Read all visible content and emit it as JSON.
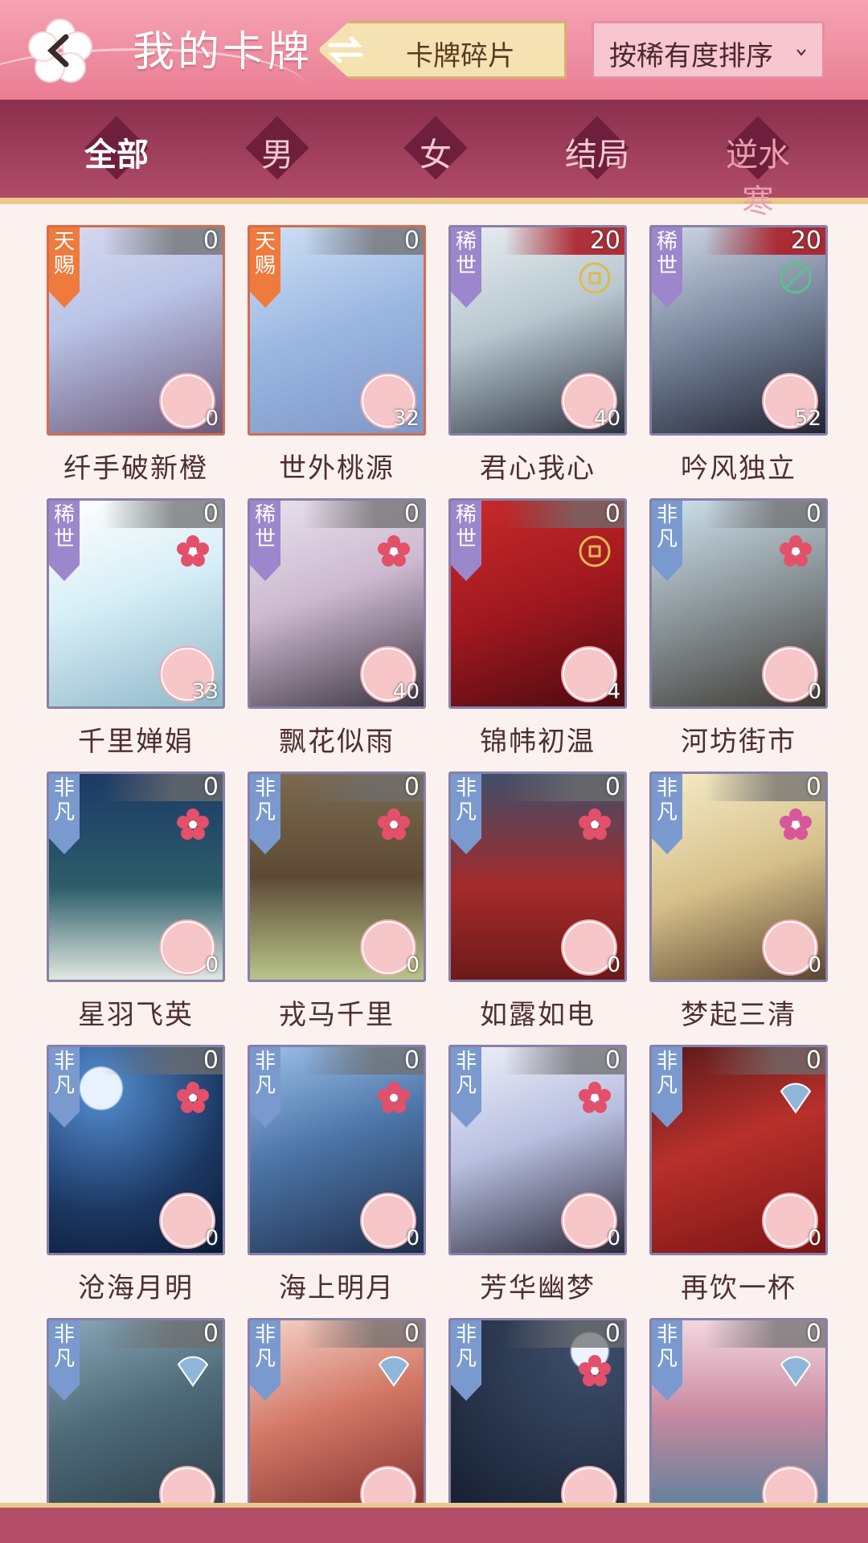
{
  "header": {
    "title": "我的卡牌",
    "switch_label": "卡牌碎片",
    "sort_label": "按稀有度排序"
  },
  "tabs": [
    {
      "label": "全部",
      "active": true
    },
    {
      "label": "男",
      "active": false
    },
    {
      "label": "女",
      "active": false
    },
    {
      "label": "结局",
      "active": false
    },
    {
      "label": "逆水寒",
      "active": false
    }
  ],
  "cards": [
    {
      "name": "纤手破新橙",
      "rarity": "天赐",
      "count": "0",
      "petals": "0"
    },
    {
      "name": "世外桃源",
      "rarity": "天赐",
      "count": "0",
      "petals": "32"
    },
    {
      "name": "君心我心",
      "rarity": "稀世",
      "count": "20",
      "petals": "40"
    },
    {
      "name": "吟风独立",
      "rarity": "稀世",
      "count": "20",
      "petals": "52"
    },
    {
      "name": "千里婵娟",
      "rarity": "稀世",
      "count": "0",
      "petals": "33"
    },
    {
      "name": "飘花似雨",
      "rarity": "稀世",
      "count": "0",
      "petals": "40"
    },
    {
      "name": "锦帏初温",
      "rarity": "稀世",
      "count": "0",
      "petals": "4"
    },
    {
      "name": "河坊街市",
      "rarity": "非凡",
      "count": "0",
      "petals": "0"
    },
    {
      "name": "星羽飞英",
      "rarity": "非凡",
      "count": "0",
      "petals": "0"
    },
    {
      "name": "戎马千里",
      "rarity": "非凡",
      "count": "0",
      "petals": "0"
    },
    {
      "name": "如露如电",
      "rarity": "非凡",
      "count": "0",
      "petals": "0"
    },
    {
      "name": "梦起三清",
      "rarity": "非凡",
      "count": "0",
      "petals": "0"
    },
    {
      "name": "沧海月明",
      "rarity": "非凡",
      "count": "0",
      "petals": "0"
    },
    {
      "name": "海上明月",
      "rarity": "非凡",
      "count": "0",
      "petals": "0"
    },
    {
      "name": "芳华幽梦",
      "rarity": "非凡",
      "count": "0",
      "petals": "0"
    },
    {
      "name": "再饮一杯",
      "rarity": "非凡",
      "count": "0",
      "petals": "0"
    },
    {
      "name": "",
      "rarity": "非凡",
      "count": "0",
      "petals": ""
    },
    {
      "name": "",
      "rarity": "非凡",
      "count": "0",
      "petals": ""
    },
    {
      "name": "",
      "rarity": "非凡",
      "count": "0",
      "petals": ""
    },
    {
      "name": "",
      "rarity": "非凡",
      "count": "0",
      "petals": ""
    }
  ],
  "colors": {
    "header": "#ea7d93",
    "band": "#8a2f4e",
    "gold_frame": "#d76a4d",
    "frame": "#8780a8"
  },
  "icons": [
    "back-arrow-icon",
    "swap-arrows-icon",
    "chevron-down-icon",
    "coin-icon",
    "plum-blossom-icon",
    "petal-badge-icon"
  ]
}
